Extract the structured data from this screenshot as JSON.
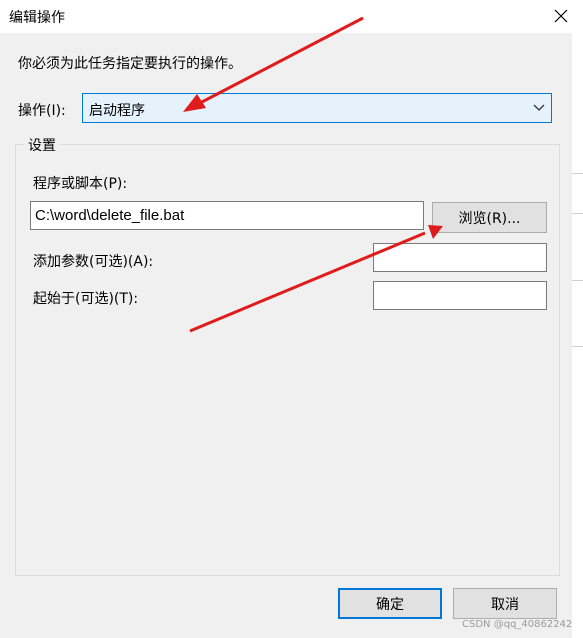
{
  "window": {
    "title": "编辑操作",
    "close_icon": "close-icon"
  },
  "instruction": "你必须为此任务指定要执行的操作。",
  "action": {
    "label": "操作(I):",
    "selected": "启动程序"
  },
  "settings": {
    "legend": "设置",
    "program_label": "程序或脚本(P):",
    "program_value": "C:\\word\\delete_file.bat",
    "browse_label": "浏览(R)...",
    "args_label": "添加参数(可选)(A):",
    "args_value": "",
    "start_label": "起始于(可选)(T):",
    "start_value": ""
  },
  "footer": {
    "ok_label": "确定",
    "cancel_label": "取消"
  },
  "watermark": "CSDN @qq_40862242",
  "colors": {
    "annotation_arrow": "#e01b1b",
    "focus_border": "#0078d7",
    "combo_background": "#e5f1fb",
    "dialog_background": "#f0f0f0"
  }
}
